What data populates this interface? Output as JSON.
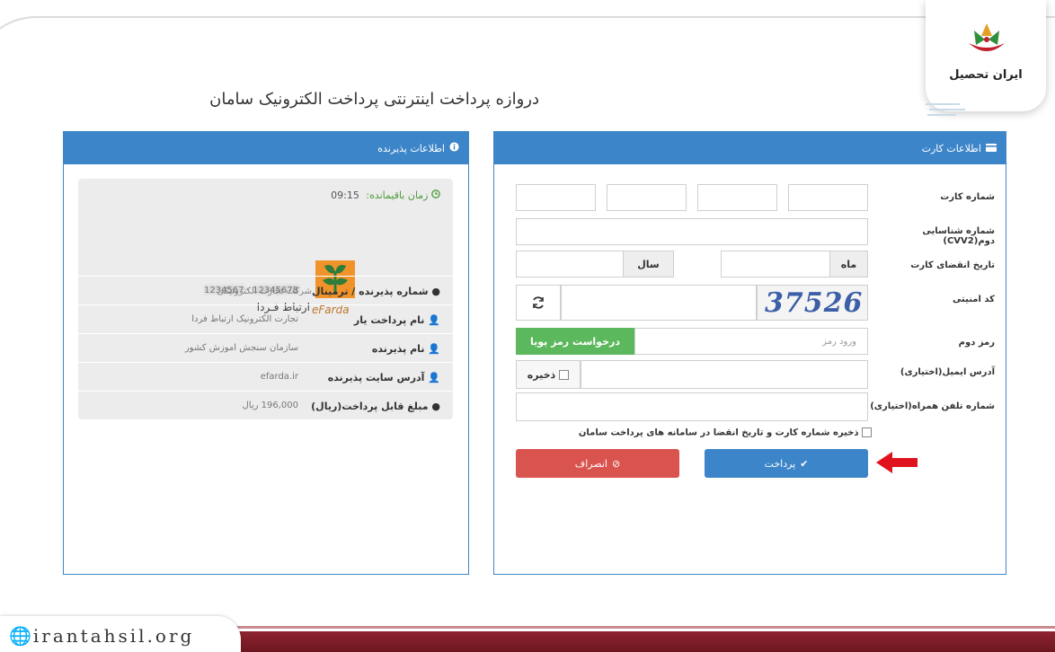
{
  "page": {
    "title": "دروازه پرداخت اینترنتی پرداخت الکترونیک سامان"
  },
  "brand": {
    "logo_text": "ایران تحصیل",
    "site": "irantahsil.org",
    "icon": "globe-icon"
  },
  "merchant_panel": {
    "header": "اطلاعات پذیرنده",
    "header_icon": "info-circle-icon",
    "timer_label": "زمان باقیمانده:",
    "timer_value": "09:15",
    "logo": {
      "word": "eFarda",
      "line1": "شرکت تجارت الکترونیکی",
      "line2": "ارتباط فـردا"
    },
    "rows": [
      {
        "label": "شماره پذیرنده / ترمینال",
        "value": "",
        "icon": "circle-icon"
      },
      {
        "label": "نام پرداخت یار",
        "value": "تجارت الکترونیک ارتباط فردا",
        "icon": "user-icon"
      },
      {
        "label": "نام پذیرنده",
        "value": "سازمان سنجش اموزش کشور",
        "icon": "user-icon"
      },
      {
        "label": "آدرس سایت پذیرنده",
        "value": "efarda.ir",
        "icon": "user-icon"
      },
      {
        "label": "مبلغ قابل پرداخت(ریال)",
        "value": "196,000 ریال",
        "icon": "circle-icon"
      }
    ]
  },
  "card_panel": {
    "header": "اطلاعات کارت",
    "header_icon": "credit-card-icon",
    "labels": {
      "card_number": "شماره کارت",
      "cvv2": "شماره شناسایی دوم(CVV2)",
      "expiry": "تاریخ انقضای کارت",
      "captcha": "کد امنیتی",
      "password": "رمز دوم",
      "email": "آدرس ایمیل(اختیاری)",
      "mobile": "شماره تلفن همراه(اختیاری)"
    },
    "expiry": {
      "month_addon": "ماه",
      "year_addon": "سال"
    },
    "captcha_text": "37526",
    "password_placeholder": "ورود رمز",
    "dynamic_pass_button": "درخواست رمز پویا",
    "email_save_label": "ذخیره",
    "save_card_label": "ذخیره شماره کارت و تاریخ انقضا در سامانه های پرداخت سامان",
    "pay_button": "پرداخت",
    "cancel_button": "انصراف"
  },
  "colors": {
    "primary": "#3d85c9",
    "success": "#5cb85c",
    "danger": "#d9534f",
    "brand_red": "#b01e2d"
  }
}
